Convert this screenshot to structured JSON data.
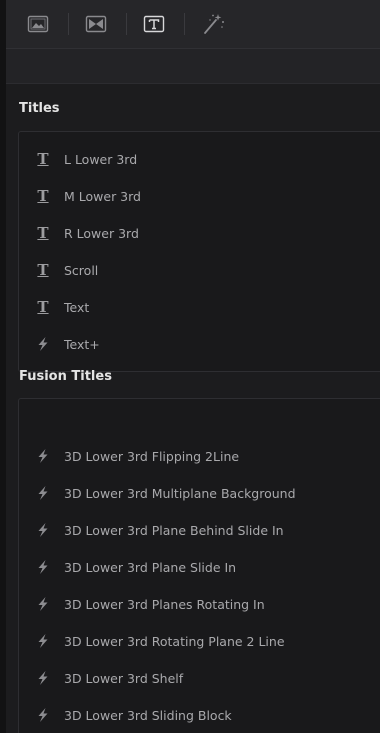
{
  "toolbar": {
    "buttons": [
      {
        "icon": "image-icon",
        "active": false
      },
      {
        "icon": "transition-icon",
        "active": false
      },
      {
        "icon": "title-icon",
        "active": true
      },
      {
        "icon": "effects-wand-icon",
        "active": false
      }
    ]
  },
  "titles": {
    "header": "Titles",
    "items": [
      {
        "label": "L Lower 3rd",
        "icon": "title-t-icon"
      },
      {
        "label": "M Lower 3rd",
        "icon": "title-t-icon"
      },
      {
        "label": "R Lower 3rd",
        "icon": "title-t-icon"
      },
      {
        "label": "Scroll",
        "icon": "title-t-icon"
      },
      {
        "label": "Text",
        "icon": "title-t-icon"
      },
      {
        "label": "Text+",
        "icon": "fusion-bolt-icon"
      }
    ]
  },
  "fusion_titles": {
    "header": "Fusion Titles",
    "items": [
      {
        "label": "3D Lower 3rd Flipping 2Line",
        "icon": "fusion-bolt-icon"
      },
      {
        "label": "3D Lower 3rd Multiplane Background",
        "icon": "fusion-bolt-icon"
      },
      {
        "label": "3D Lower 3rd Plane Behind Slide In",
        "icon": "fusion-bolt-icon"
      },
      {
        "label": "3D Lower 3rd Plane Slide In",
        "icon": "fusion-bolt-icon"
      },
      {
        "label": "3D Lower 3rd Planes Rotating In",
        "icon": "fusion-bolt-icon"
      },
      {
        "label": "3D Lower 3rd Rotating Plane 2 Line",
        "icon": "fusion-bolt-icon"
      },
      {
        "label": "3D Lower 3rd Shelf",
        "icon": "fusion-bolt-icon"
      },
      {
        "label": "3D Lower 3rd Sliding Block",
        "icon": "fusion-bolt-icon"
      }
    ]
  },
  "colors": {
    "background": "#1c1c1e",
    "panel": "#19191b",
    "text": "#a9a9ac",
    "header_text": "#e4e4e4",
    "icon": "#9c9c9f"
  }
}
